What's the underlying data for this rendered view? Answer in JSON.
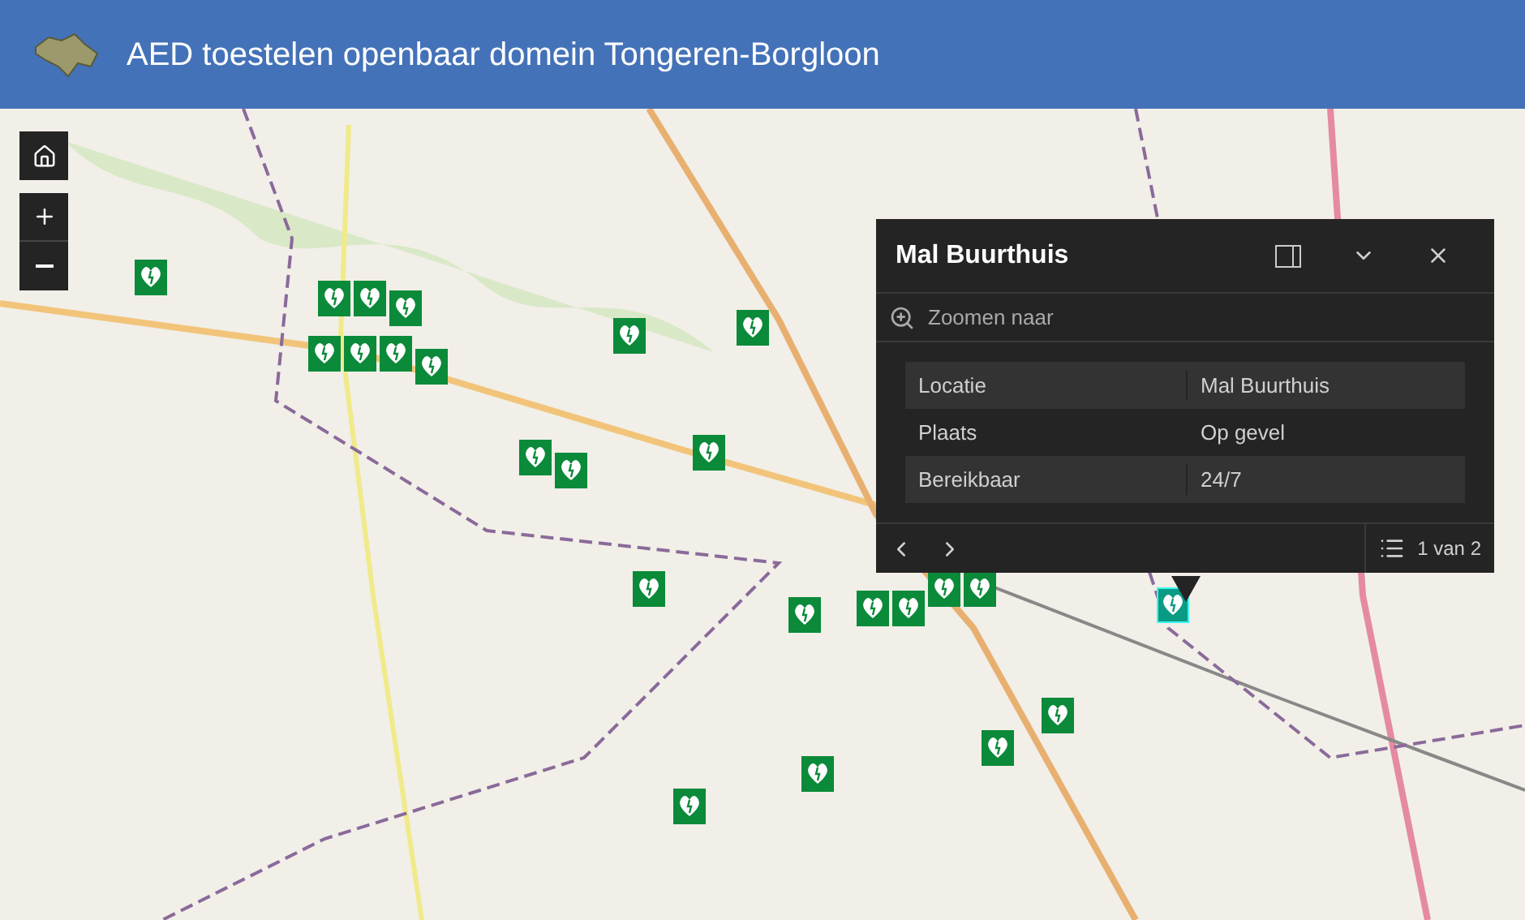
{
  "header": {
    "title": "AED toestelen openbaar domein Tongeren-Borgloon"
  },
  "map": {
    "markers": [
      {
        "selected": false
      },
      {
        "selected": false
      },
      {
        "selected": false
      },
      {
        "selected": false
      },
      {
        "selected": false
      },
      {
        "selected": false
      },
      {
        "selected": false
      },
      {
        "selected": false
      },
      {
        "selected": false
      },
      {
        "selected": false
      },
      {
        "selected": false
      },
      {
        "selected": false
      },
      {
        "selected": false
      },
      {
        "selected": false
      },
      {
        "selected": false
      },
      {
        "selected": false
      },
      {
        "selected": false
      },
      {
        "selected": false
      },
      {
        "selected": false
      },
      {
        "selected": true
      },
      {
        "selected": false
      },
      {
        "selected": false
      },
      {
        "selected": false
      },
      {
        "selected": false
      }
    ]
  },
  "popup": {
    "title": "Mal Buurthuis",
    "zoom_action": "Zoomen naar",
    "rows": [
      {
        "label": "Locatie",
        "value": "Mal Buurthuis"
      },
      {
        "label": "Plaats",
        "value": "Op gevel"
      },
      {
        "label": "Bereikbaar",
        "value": "24/7"
      }
    ],
    "pager": "1 van 2"
  }
}
